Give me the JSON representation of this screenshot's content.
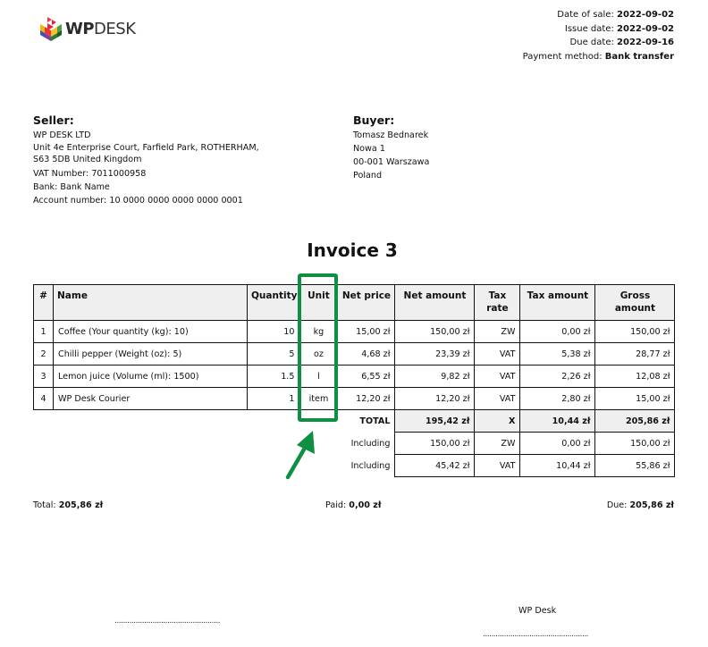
{
  "logo": {
    "brand_bold": "WP",
    "brand_light": "DESK"
  },
  "meta": {
    "date_of_sale_label": "Date of sale:",
    "date_of_sale": "2022-09-02",
    "issue_date_label": "Issue date:",
    "issue_date": "2022-09-02",
    "due_date_label": "Due date:",
    "due_date": "2022-09-16",
    "payment_method_label": "Payment method:",
    "payment_method": "Bank transfer"
  },
  "seller": {
    "heading": "Seller:",
    "name": "WP DESK LTD",
    "address_line1": "Unit 4e Enterprise Court, Farfield Park, ROTHERHAM,",
    "address_line2": "S63 5DB United Kingdom",
    "vat": "VAT Number: 7011000958",
    "bank": "Bank: Bank Name",
    "account": "Account number: 10 0000 0000 0000 0000 0001"
  },
  "buyer": {
    "heading": "Buyer:",
    "name": "Tomasz Bednarek",
    "street": "Nowa 1",
    "city": "00-001 Warszawa",
    "country": "Poland"
  },
  "invoice_title": "Invoice 3",
  "table": {
    "headers": {
      "num": "#",
      "name": "Name",
      "quantity": "Quantity",
      "unit": "Unit",
      "net_price": "Net price",
      "net_amount": "Net amount",
      "tax_rate": "Tax rate",
      "tax_amount": "Tax amount",
      "gross_amount": "Gross amount"
    },
    "rows": [
      {
        "num": "1",
        "name": "Coffee (Your quantity (kg): 10)",
        "quantity": "10",
        "unit": "kg",
        "net_price": "15,00 zł",
        "net_amount": "150,00 zł",
        "tax_rate": "ZW",
        "tax_amount": "0,00 zł",
        "gross_amount": "150,00 zł"
      },
      {
        "num": "2",
        "name": "Chilli pepper (Weight (oz): 5)",
        "quantity": "5",
        "unit": "oz",
        "net_price": "4,68 zł",
        "net_amount": "23,39 zł",
        "tax_rate": "VAT",
        "tax_amount": "5,38 zł",
        "gross_amount": "28,77 zł"
      },
      {
        "num": "3",
        "name": "Lemon juice (Volume (ml): 1500)",
        "quantity": "1.5",
        "unit": "l",
        "net_price": "6,55 zł",
        "net_amount": "9,82 zł",
        "tax_rate": "VAT",
        "tax_amount": "2,26 zł",
        "gross_amount": "12,08 zł"
      },
      {
        "num": "4",
        "name": "WP Desk Courier",
        "quantity": "1",
        "unit": "item",
        "net_price": "12,20 zł",
        "net_amount": "12,20 zł",
        "tax_rate": "VAT",
        "tax_amount": "2,80 zł",
        "gross_amount": "15,00 zł"
      }
    ],
    "total": {
      "label": "TOTAL",
      "net_amount": "195,42 zł",
      "tax_rate": "X",
      "tax_amount": "10,44 zł",
      "gross_amount": "205,86 zł"
    },
    "including": [
      {
        "label": "Including",
        "net_amount": "150,00 zł",
        "tax_rate": "ZW",
        "tax_amount": "0,00 zł",
        "gross_amount": "150,00 zł"
      },
      {
        "label": "Including",
        "net_amount": "45,42 zł",
        "tax_rate": "VAT",
        "tax_amount": "10,44 zł",
        "gross_amount": "55,86 zł"
      }
    ]
  },
  "summary": {
    "total_label": "Total:",
    "total": "205,86 zł",
    "paid_label": "Paid:",
    "paid": "0,00 zł",
    "due_label": "Due:",
    "due": "205,86 zł"
  },
  "signatures": {
    "left_line": "..................................................",
    "right_name": "WP Desk",
    "right_line": ".................................................."
  },
  "annotation": {
    "highlight_color": "#0f8f44"
  }
}
